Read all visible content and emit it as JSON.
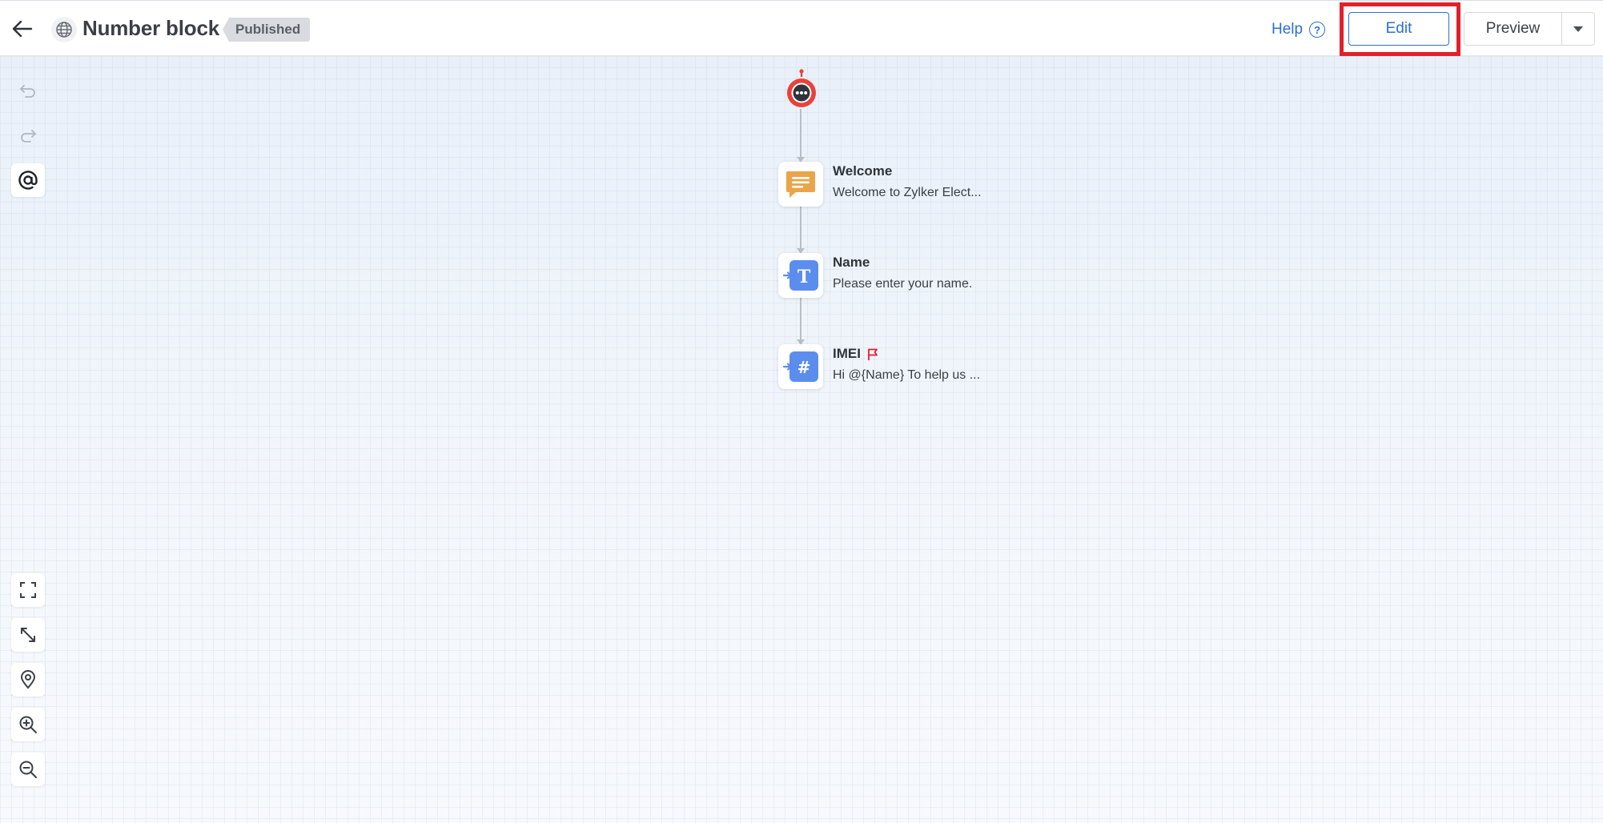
{
  "header": {
    "bot_name": "Number block",
    "status": "Published",
    "help_label": "Help",
    "help_icon": "?",
    "edit_label": "Edit",
    "preview_label": "Preview"
  },
  "colors": {
    "accent": "#2c6fd6",
    "highlight": "#e0202c",
    "welcome_node": "#eba449",
    "input_node": "#5b8def",
    "start_node": "#e8423b"
  },
  "toolbar": {
    "top": [
      "undo-icon",
      "redo-icon",
      "mention-icon"
    ],
    "bottom": [
      "fit-screen-icon",
      "expand-icon",
      "location-pin-icon",
      "zoom-in-icon",
      "zoom-out-icon"
    ]
  },
  "flow": {
    "nodes": [
      {
        "icon": "message-icon",
        "title": "Welcome",
        "subtitle": "Welcome to Zylker Elect..."
      },
      {
        "icon": "text-input-icon",
        "title": "Name",
        "subtitle": "Please enter your name."
      },
      {
        "icon": "number-input-icon",
        "title": "IMEI",
        "subtitle": "Hi  @{Name}  To help us ...",
        "flagged": true
      }
    ]
  }
}
